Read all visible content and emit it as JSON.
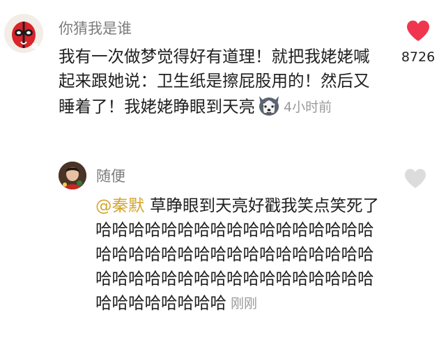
{
  "main_comment": {
    "username": "你猜我是谁",
    "text": "我有一次做梦觉得好有道理！就把我姥姥喊起来跟她说：卫生纸是擦屁股用的！然后又睡着了！我姥姥睁眼到天亮",
    "time": "4小时前",
    "likes": "8726",
    "liked": true,
    "inline_icon": "husky-dog-emoji",
    "like_color": "#f0364f"
  },
  "reply": {
    "username": "随便",
    "mention": "@秦默",
    "text": " 草睁眼到天亮好戳我笑点笑死了哈哈哈哈哈哈哈哈哈哈哈哈哈哈哈哈哈哈哈哈哈哈哈哈哈哈哈哈哈哈哈哈哈哈哈哈哈哈哈哈哈哈哈哈哈哈哈哈哈哈哈哈哈哈哈哈哈哈哈",
    "time": "刚刚",
    "liked": false,
    "mention_color": "#d4a62e"
  }
}
